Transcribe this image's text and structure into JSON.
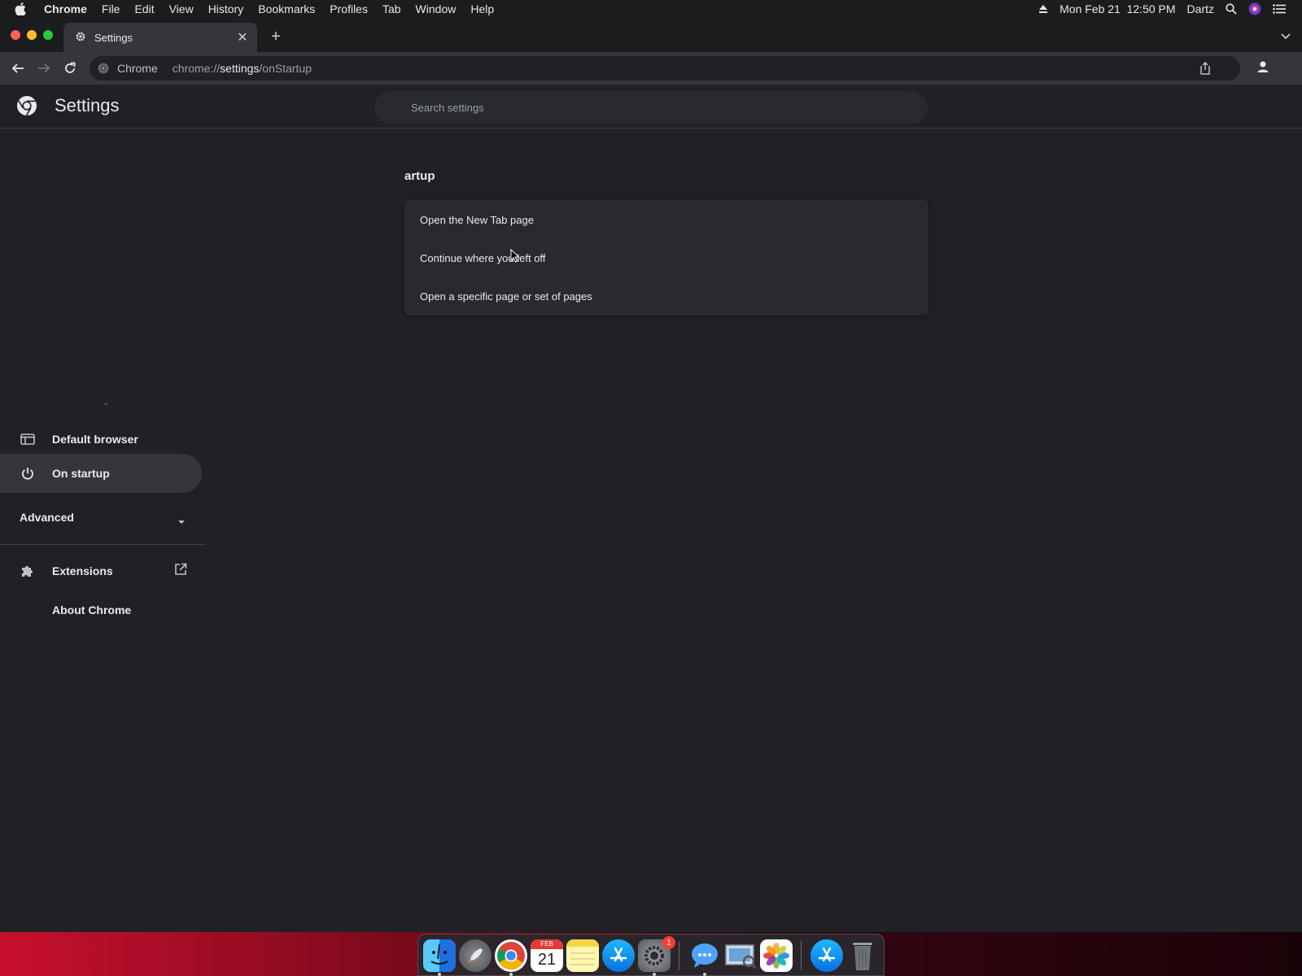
{
  "menubar": {
    "app": "Chrome",
    "items": [
      "File",
      "Edit",
      "View",
      "History",
      "Bookmarks",
      "Profiles",
      "Tab",
      "Window",
      "Help"
    ],
    "datetime": "Mon Feb 21  12:50 PM",
    "user": "Dartz"
  },
  "tab": {
    "title": "Settings"
  },
  "omnibox": {
    "origin": "Chrome",
    "url_prefix": "chrome://",
    "url_host": "settings",
    "url_path": "/onStartup"
  },
  "header": {
    "title": "Settings",
    "search_placeholder": "Search settings"
  },
  "sidebar": {
    "dash": "-",
    "default_browser": "Default browser",
    "on_startup": "On startup",
    "advanced": "Advanced",
    "extensions": "Extensions",
    "about": "About Chrome"
  },
  "main": {
    "section_title": "artup",
    "options": [
      "Open the New Tab page",
      "Continue where you left off",
      "Open a specific page or set of pages"
    ]
  },
  "dock": {
    "calendar_month": "FEB",
    "calendar_day": "21",
    "settings_badge": "1"
  },
  "colors": {
    "background": "#202124",
    "card": "#292a2d",
    "active_item": "#35363a",
    "text": "#e8eaed"
  }
}
